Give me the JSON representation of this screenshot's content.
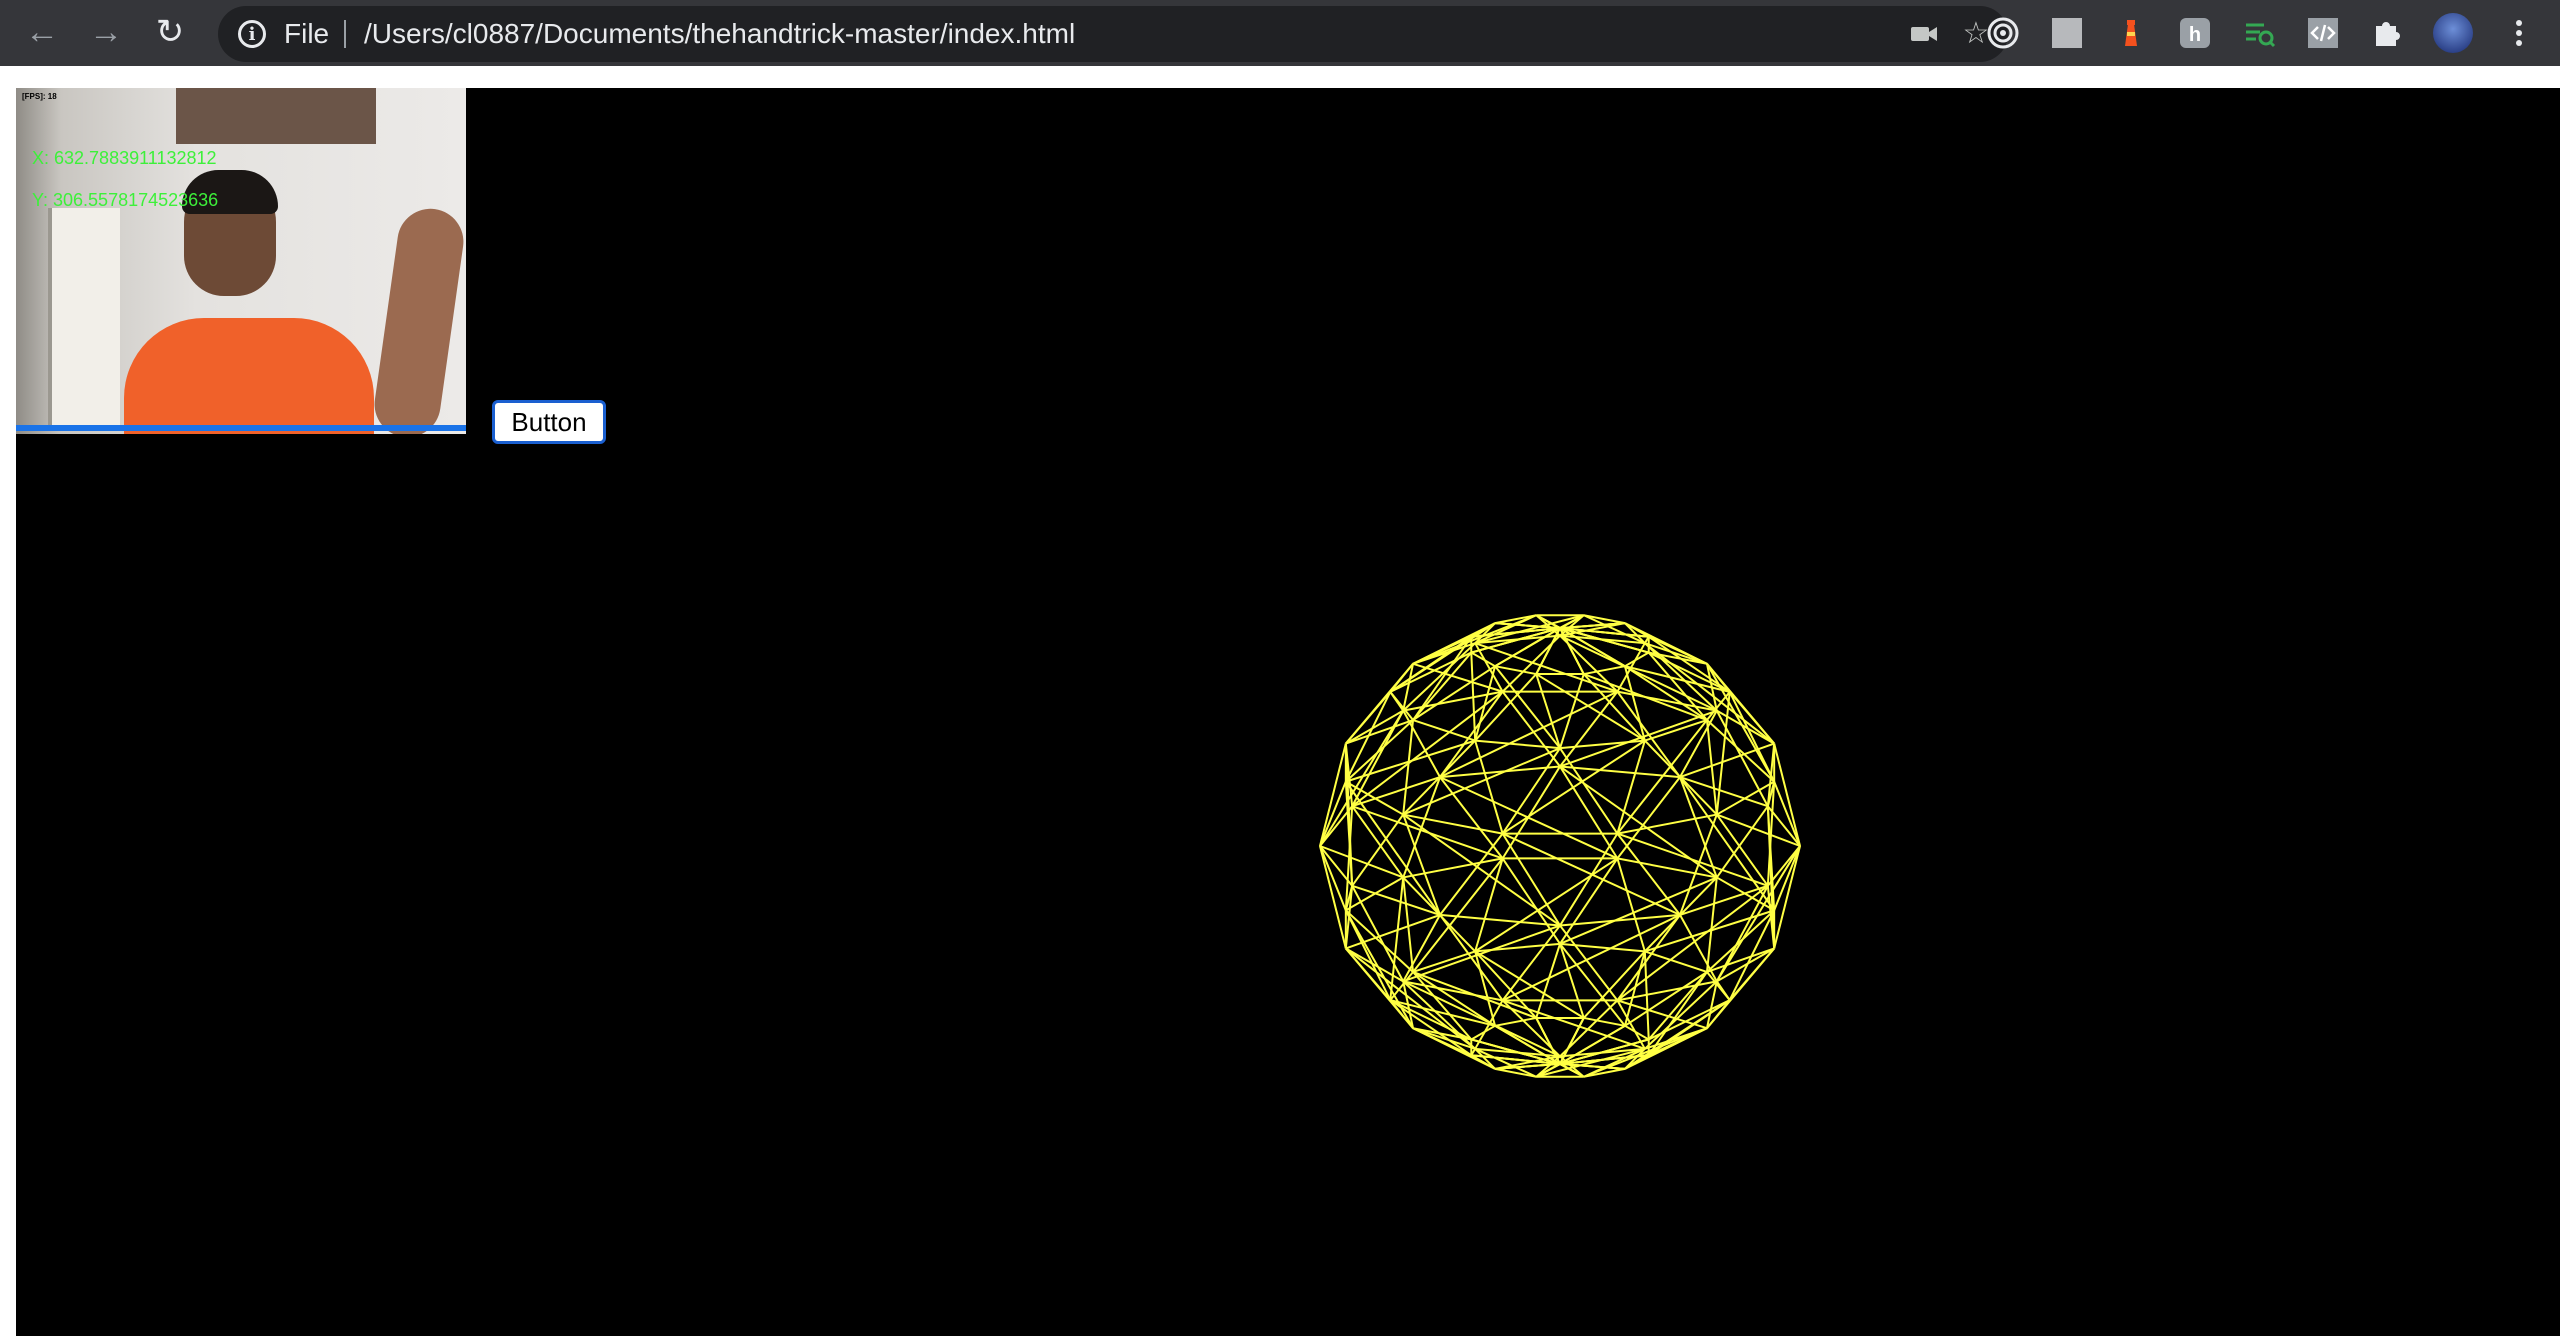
{
  "browser": {
    "scheme_label": "File",
    "url": "/Users/cl0887/Documents/thehandtrick-master/index.html",
    "nav": {
      "back_icon": "arrow-left-icon",
      "forward_icon": "arrow-right-icon",
      "reload_icon": "reload-icon"
    },
    "omnibox_icons": [
      "site-info-icon",
      "camera-icon",
      "bookmark-star-icon"
    ],
    "extensions": [
      "target-icon",
      "gray-square-icon",
      "lighthouse-icon",
      "h-icon",
      "search-lines-icon",
      "code-icon",
      "puzzle-icon"
    ],
    "menu_icon": "vertical-dots-icon"
  },
  "video": {
    "fps_label": "[FPS]: 18",
    "x_label": "X: 632.7883911132812",
    "y_label": "Y: 306.5578174523636"
  },
  "page": {
    "button_label": "Button"
  },
  "scene": {
    "object": "wireframe-sphere",
    "color": "#ffff44",
    "background": "#000000"
  }
}
